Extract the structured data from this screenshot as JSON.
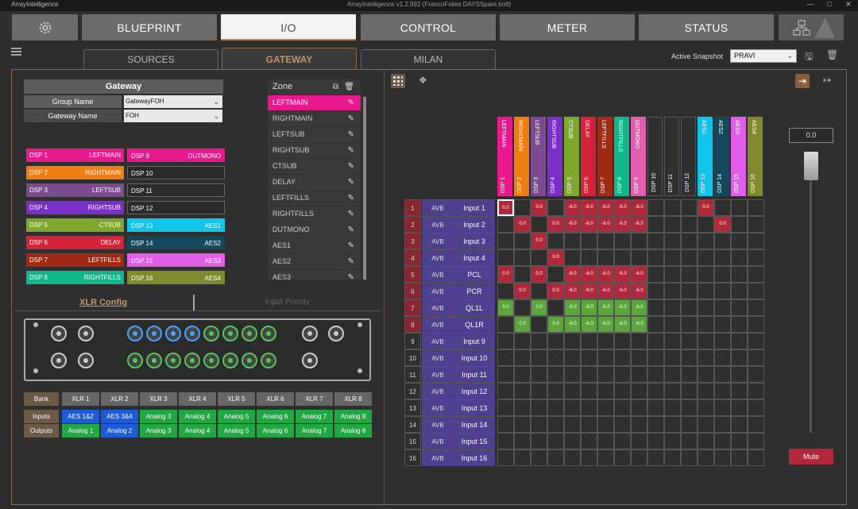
{
  "app": {
    "name": "ArrayIntelligence",
    "title": "ArrayIntelligence v1.2.992 (FrancoFolies DAYSSpare.bolt)"
  },
  "nav": {
    "blueprint": "BLUEPRINT",
    "io": "I/O",
    "control": "CONTROL",
    "meter": "METER",
    "status": "STATUS"
  },
  "subtabs": {
    "sources": "SOURCES",
    "gateway": "GATEWAY",
    "milan": "MILAN"
  },
  "snapshot": {
    "label": "Active Snapshot",
    "value": "PRAVI"
  },
  "gateway": {
    "header": "Gateway",
    "group_label": "Group Name",
    "group_value": "GatewayFOH",
    "name_label": "Gateway Name",
    "name_value": "FOH"
  },
  "dsp_left": [
    {
      "n": "DSP 1",
      "z": "LEFTMAIN",
      "c": "#e8198c"
    },
    {
      "n": "DSP 2",
      "z": "RIGHTMAIN",
      "c": "#f07d12"
    },
    {
      "n": "DSP 3",
      "z": "LEFTSUB",
      "c": "#7b4a8f"
    },
    {
      "n": "DSP 4",
      "z": "RIGHTSUB",
      "c": "#7a2fc7"
    },
    {
      "n": "DSP 5",
      "z": "CTSUB",
      "c": "#7ea82b"
    },
    {
      "n": "DSP 6",
      "z": "DELAY",
      "c": "#d4223a"
    },
    {
      "n": "DSP 7",
      "z": "LEFTFILLS",
      "c": "#a02a12"
    },
    {
      "n": "DSP 8",
      "z": "RIGHTFILLS",
      "c": "#11b78a"
    }
  ],
  "dsp_right": [
    {
      "n": "DSP 9",
      "z": "DUTMONO",
      "c": "#e8198c"
    },
    {
      "n": "DSP 10",
      "z": "",
      "c": ""
    },
    {
      "n": "DSP 11",
      "z": "",
      "c": ""
    },
    {
      "n": "DSP 12",
      "z": "",
      "c": ""
    },
    {
      "n": "DSP 13",
      "z": "AES1",
      "c": "#10c4ea"
    },
    {
      "n": "DSP 14",
      "z": "AES2",
      "c": "#15485c"
    },
    {
      "n": "DSP 15",
      "z": "AES3",
      "c": "#e05ee8"
    },
    {
      "n": "DSP 16",
      "z": "AES4",
      "c": "#7e8a2b"
    }
  ],
  "zone": {
    "header": "Zone",
    "items": [
      "LEFTMAIN",
      "RIGHTMAIN",
      "LEFTSUB",
      "RIGHTSUB",
      "CTSUB",
      "DELAY",
      "LEFTFILLS",
      "RIGHTFILLS",
      "DUTMONO",
      "AES1",
      "AES2",
      "AES3"
    ]
  },
  "xlr": {
    "tab": "XLR Config",
    "prio_tab": "Input Priority"
  },
  "bank": {
    "labels": [
      "Bank",
      "Inputs",
      "Outputs"
    ],
    "xlr": [
      "XLR 1",
      "XLR 2",
      "XLR 3",
      "XLR 4",
      "XLR 5",
      "XLR 6",
      "XLR 7",
      "XLR 8"
    ],
    "inputs": [
      "AES 1&2",
      "AES 3&4",
      "Analog 3",
      "Analog 4",
      "Analog 5",
      "Analog 6",
      "Analog 7",
      "Analog 8"
    ],
    "outputs": [
      "Analog 1",
      "Analog 2",
      "Analog 3",
      "Analog 4",
      "Analog 5",
      "Analog 6",
      "Analog 7",
      "Analog 8"
    ]
  },
  "matrix": {
    "cols": [
      {
        "z": "LEFTMAIN",
        "d": "DSP 1",
        "c": "#e8198c"
      },
      {
        "z": "RIGHTMAIN",
        "d": "DSP 2",
        "c": "#f07d12"
      },
      {
        "z": "LEFTSUB",
        "d": "DSP 3",
        "c": "#7b4a8f"
      },
      {
        "z": "RIGHTSUB",
        "d": "DSP 4",
        "c": "#7a2fc7"
      },
      {
        "z": "CTSUB",
        "d": "DSP 5",
        "c": "#7ea82b"
      },
      {
        "z": "DELAY",
        "d": "DSP 6",
        "c": "#d4223a"
      },
      {
        "z": "LEFTFILLS",
        "d": "DSP 7",
        "c": "#a02a12"
      },
      {
        "z": "RIGHTFILLS",
        "d": "DSP 8",
        "c": "#11b78a"
      },
      {
        "z": "DUTMONO",
        "d": "DSP 9",
        "c": "#e05eae"
      },
      {
        "z": "",
        "d": "DSP 10",
        "c": ""
      },
      {
        "z": "",
        "d": "DSP 11",
        "c": ""
      },
      {
        "z": "",
        "d": "DSP 12",
        "c": ""
      },
      {
        "z": "AES1",
        "d": "DSP 13",
        "c": "#10c4ea"
      },
      {
        "z": "AES2",
        "d": "DSP 14",
        "c": "#15485c"
      },
      {
        "z": "AES3",
        "d": "DSP 15",
        "c": "#e05ee8"
      },
      {
        "z": "AES4",
        "d": "DSP 16",
        "c": "#7e8a2b"
      }
    ],
    "rows": [
      {
        "n": "1",
        "t": "AVB",
        "i": "Input 1",
        "v": {
          "0": "0.0",
          "2": "0.0",
          "4": "-6.0",
          "5": "-6.0",
          "6": "-6.0",
          "7": "-6.0",
          "8": "-6.0",
          "12": "0.0"
        },
        "c": "#b0283a"
      },
      {
        "n": "2",
        "t": "AVB",
        "i": "Input 2",
        "v": {
          "1": "0.0",
          "3": "0.0",
          "4": "-6.0",
          "5": "-6.0",
          "6": "-6.0",
          "7": "-6.0",
          "8": "-6.0",
          "13": "0.0"
        },
        "c": "#b0283a"
      },
      {
        "n": "3",
        "t": "AVB",
        "i": "Input 3",
        "v": {
          "2": "0.0"
        },
        "c": "#b0283a"
      },
      {
        "n": "4",
        "t": "AVB",
        "i": "Input 4",
        "v": {
          "3": "0.0"
        },
        "c": "#b0283a"
      },
      {
        "n": "5",
        "t": "AVB",
        "i": "PCL",
        "v": {
          "0": "0.0",
          "2": "0.0",
          "4": "-6.0",
          "5": "-6.0",
          "6": "-6.0",
          "7": "-6.0",
          "8": "-6.0"
        },
        "c": "#b0283a"
      },
      {
        "n": "6",
        "t": "AVB",
        "i": "PCR",
        "v": {
          "1": "0.0",
          "3": "0.0",
          "4": "-6.0",
          "5": "-6.0",
          "6": "-6.0",
          "7": "-6.0",
          "8": "-6.0"
        },
        "c": "#b0283a"
      },
      {
        "n": "7",
        "t": "AVB",
        "i": "QL1L",
        "v": {
          "0": "0.0",
          "2": "0.0",
          "4": "-6.0",
          "5": "-6.0",
          "6": "-6.0",
          "7": "-6.0",
          "8": "-6.0"
        },
        "c": "#5aa63a"
      },
      {
        "n": "8",
        "t": "AVB",
        "i": "QL1R",
        "v": {
          "1": "0.0",
          "3": "0.0",
          "4": "-6.0",
          "5": "-6.0",
          "6": "-6.0",
          "7": "-6.0",
          "8": "-6.0"
        },
        "c": "#5aa63a"
      },
      {
        "n": "9",
        "t": "AVB",
        "i": "Input 9",
        "v": {},
        "c": ""
      },
      {
        "n": "10",
        "t": "AVB",
        "i": "Input 10",
        "v": {},
        "c": ""
      },
      {
        "n": "11",
        "t": "AVB",
        "i": "Input 11",
        "v": {},
        "c": ""
      },
      {
        "n": "12",
        "t": "AVB",
        "i": "Input 12",
        "v": {},
        "c": ""
      },
      {
        "n": "13",
        "t": "AVB",
        "i": "Input 13",
        "v": {},
        "c": ""
      },
      {
        "n": "14",
        "t": "AVB",
        "i": "Input 14",
        "v": {},
        "c": ""
      },
      {
        "n": "15",
        "t": "AVB",
        "i": "Input 15",
        "v": {},
        "c": ""
      },
      {
        "n": "16",
        "t": "AVB",
        "i": "Input 16",
        "v": {},
        "c": ""
      }
    ]
  },
  "fader": {
    "value": "0.0",
    "mute": "Mute"
  }
}
